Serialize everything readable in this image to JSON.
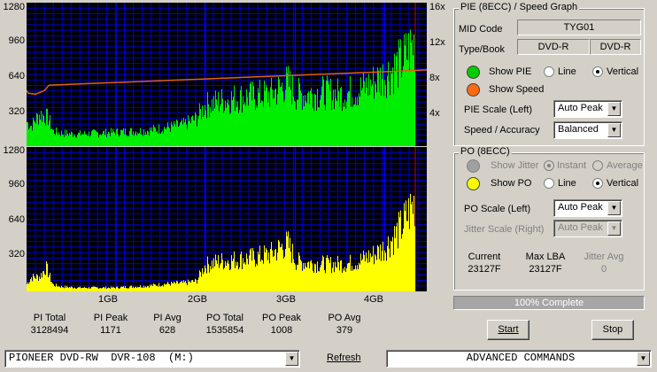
{
  "chart_data": [
    {
      "type": "area",
      "title": "",
      "xlabel": "",
      "ylabel": "PIE",
      "y_ticks": [
        "1280",
        "960",
        "640",
        "320"
      ],
      "right_axis_ticks": [
        "16x",
        "12x",
        "8x",
        "4x"
      ],
      "ylim": [
        0,
        1280
      ],
      "right_ylim": [
        0,
        16
      ],
      "xlim_gb": [
        0,
        4.47
      ],
      "series": [
        {
          "name": "PIE",
          "color": "#00ee00",
          "x": [
            0,
            0.05,
            0.15,
            0.25,
            0.3,
            0.4,
            0.6,
            0.8,
            1.0,
            1.2,
            1.4,
            1.6,
            1.8,
            1.95,
            2.05,
            2.2,
            2.4,
            2.6,
            2.8,
            2.9,
            3.0,
            3.1,
            3.2,
            3.4,
            3.6,
            3.8,
            3.9,
            4.0,
            4.1,
            4.2,
            4.3,
            4.4,
            4.47
          ],
          "y": [
            260,
            220,
            350,
            300,
            160,
            140,
            130,
            140,
            150,
            160,
            170,
            200,
            230,
            300,
            440,
            480,
            520,
            540,
            560,
            620,
            680,
            560,
            560,
            580,
            560,
            600,
            640,
            700,
            760,
            820,
            900,
            1040,
            1140
          ]
        },
        {
          "name": "Speed",
          "color": "#e06010",
          "x": [
            0,
            0.02,
            0.1,
            0.2,
            0.25,
            0.5,
            1.0,
            1.5,
            2.0,
            2.5,
            3.0,
            3.5,
            4.0,
            4.47
          ],
          "y": [
            6.2,
            5.9,
            5.8,
            6.2,
            6.8,
            6.9,
            7.1,
            7.3,
            7.5,
            7.7,
            7.9,
            8.1,
            8.3,
            8.5
          ]
        }
      ]
    },
    {
      "type": "area",
      "title": "",
      "ylabel": "PO",
      "y_ticks": [
        "1280",
        "960",
        "640",
        "320"
      ],
      "ylim": [
        0,
        1280
      ],
      "x_ticks": [
        "1GB",
        "2GB",
        "3GB",
        "4GB"
      ],
      "xlim_gb": [
        0,
        4.47
      ],
      "series": [
        {
          "name": "PO",
          "color": "#ffff00",
          "x": [
            0,
            0.05,
            0.15,
            0.22,
            0.3,
            0.4,
            0.6,
            0.8,
            1.0,
            1.2,
            1.4,
            1.6,
            1.8,
            1.95,
            2.05,
            2.2,
            2.4,
            2.6,
            2.8,
            2.9,
            3.0,
            3.1,
            3.3,
            3.5,
            3.7,
            3.8,
            3.9,
            4.0,
            4.1,
            4.2,
            4.3,
            4.4,
            4.47
          ],
          "y": [
            80,
            150,
            160,
            260,
            70,
            50,
            40,
            40,
            40,
            50,
            60,
            80,
            90,
            110,
            280,
            320,
            340,
            360,
            400,
            460,
            510,
            320,
            300,
            290,
            300,
            320,
            360,
            400,
            460,
            560,
            680,
            860,
            980
          ]
        }
      ]
    }
  ],
  "stats": [
    {
      "label": "PI Total",
      "value": "3128494"
    },
    {
      "label": "PI Peak",
      "value": "1171"
    },
    {
      "label": "PI Avg",
      "value": "628"
    },
    {
      "label": "PO Total",
      "value": "1535854"
    },
    {
      "label": "PO Peak",
      "value": "1008"
    },
    {
      "label": "PO Avg",
      "value": "379"
    }
  ],
  "pie_group": {
    "title": "PIE (8ECC) / Speed Graph",
    "mid_code_label": "MID Code",
    "mid_code": "TYG01",
    "type_book_label": "Type/Book",
    "type": "DVD-R",
    "book": "DVD-R",
    "show_pie": "Show PIE",
    "show_speed": "Show Speed",
    "line": "Line",
    "vertical": "Vertical",
    "scale_label": "PIE Scale (Left)",
    "scale_value": "Auto Peak",
    "speed_label": "Speed / Accuracy",
    "speed_value": "Balanced",
    "pie_color": "#00cc00",
    "speed_color": "#ff6a10"
  },
  "po_group": {
    "title": "PO (8ECC)",
    "show_jitter": "Show Jitter",
    "instant": "Instant",
    "average": "Average",
    "show_po": "Show PO",
    "line": "Line",
    "vertical": "Vertical",
    "scale_label": "PO Scale (Left)",
    "scale_value": "Auto Peak",
    "jitter_label": "Jitter Scale (Right)",
    "jitter_value": "Auto Peak",
    "current_label": "Current",
    "current_value": "23127F",
    "maxlba_label": "Max LBA",
    "maxlba_value": "23127F",
    "jitter_avg_label": "Jitter Avg",
    "jitter_avg_value": "0",
    "po_color": "#ffff00"
  },
  "progress": {
    "text": "100% Complete",
    "fraction": 1.0
  },
  "buttons": {
    "start": "Start",
    "stop": "Stop",
    "refresh": "Refresh"
  },
  "drive": "PIONEER DVD-RW  DVR-108  (M:)",
  "advanced": "ADVANCED COMMANDS"
}
